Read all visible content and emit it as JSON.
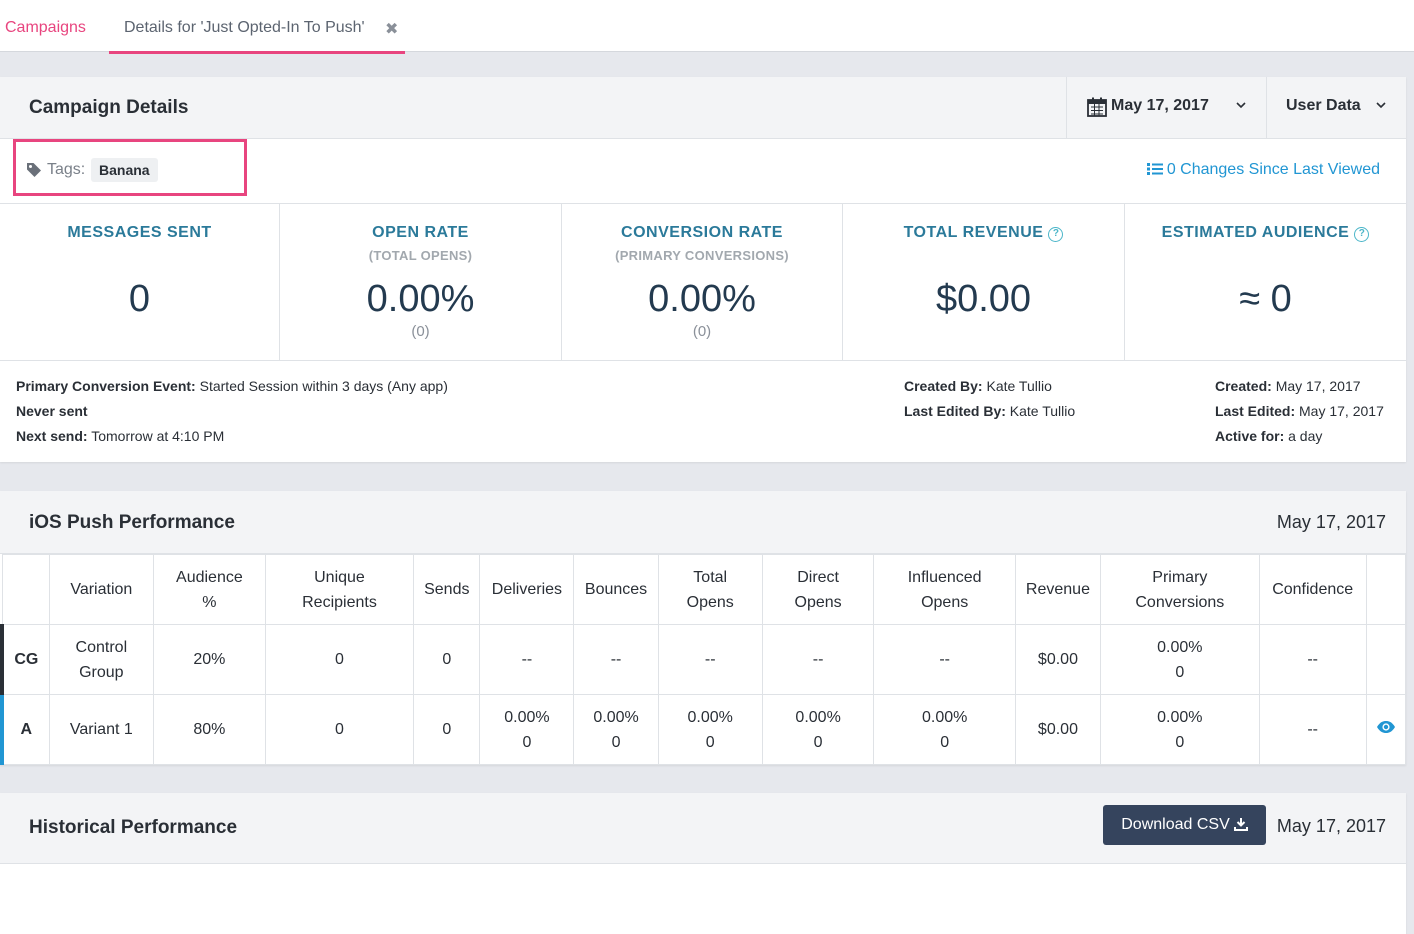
{
  "tabs": {
    "campaigns": "Campaigns",
    "details": "Details for 'Just Opted-In To Push'",
    "close_glyph": "✖"
  },
  "details": {
    "title": "Campaign Details",
    "date_filter": "May 17, 2017",
    "data_filter": "User Data",
    "tags_label": "Tags:",
    "tag": "Banana",
    "changes_link": "0 Changes Since Last Viewed",
    "stats": [
      {
        "title": "MESSAGES SENT",
        "sub": "",
        "value": "0",
        "count": ""
      },
      {
        "title": "OPEN RATE",
        "sub": "(TOTAL OPENS)",
        "value": "0.00%",
        "count": "(0)"
      },
      {
        "title": "CONVERSION RATE",
        "sub": "(PRIMARY CONVERSIONS)",
        "value": "0.00%",
        "count": "(0)"
      },
      {
        "title": "TOTAL REVENUE",
        "sub": "",
        "value": "$0.00",
        "count": ""
      },
      {
        "title": "ESTIMATED AUDIENCE",
        "sub": "",
        "value": "≈ 0",
        "count": ""
      }
    ],
    "meta_left": {
      "conversion_label": "Primary Conversion Event:",
      "conversion_value": "Started Session within 3 days (Any app)",
      "never_sent": "Never sent",
      "next_send_label": "Next send:",
      "next_send_value": "Tomorrow at 4:10 PM"
    },
    "meta_mid": {
      "created_by_label": "Created By:",
      "created_by_value": "Kate Tullio",
      "edited_by_label": "Last Edited By:",
      "edited_by_value": "Kate Tullio"
    },
    "meta_right": {
      "created_label": "Created:",
      "created_value": "May 17, 2017",
      "edited_label": "Last Edited:",
      "edited_value": "May 17, 2017",
      "active_label": "Active for:",
      "active_value": "a day"
    }
  },
  "ios": {
    "title": "iOS Push Performance",
    "date": "May 17, 2017",
    "columns": [
      "",
      "Variation",
      "Audience %",
      "Unique Recipients",
      "Sends",
      "Deliveries",
      "Bounces",
      "Total Opens",
      "Direct Opens",
      "Influenced Opens",
      "Revenue",
      "Primary Conversions",
      "Confidence",
      ""
    ],
    "rows": [
      {
        "tag": "CG",
        "variation": "Control Group",
        "audience": "20%",
        "unique": "0",
        "sends": "0",
        "deliveries": "--",
        "bounces": "--",
        "total_opens": "--",
        "direct_opens": "--",
        "influenced_opens": "--",
        "revenue": "$0.00",
        "conv_pct": "0.00%",
        "conv_count": "0",
        "confidence": "--"
      },
      {
        "tag": "A",
        "variation": "Variant 1",
        "audience": "80%",
        "unique": "0",
        "sends": "0",
        "deliveries_pct": "0.00%",
        "deliveries_count": "0",
        "bounces_pct": "0.00%",
        "bounces_count": "0",
        "total_opens_pct": "0.00%",
        "total_opens_count": "0",
        "direct_opens_pct": "0.00%",
        "direct_opens_count": "0",
        "influenced_pct": "0.00%",
        "influenced_count": "0",
        "revenue": "$0.00",
        "conv_pct": "0.00%",
        "conv_count": "0",
        "confidence": "--"
      }
    ]
  },
  "historical": {
    "title": "Historical Performance",
    "download": "Download CSV",
    "date": "May 17, 2017"
  },
  "colors": {
    "accent_pink": "#e8457f",
    "link_blue": "#2196d3",
    "stat_teal": "#2b7a9a",
    "button_navy": "#35445d"
  }
}
